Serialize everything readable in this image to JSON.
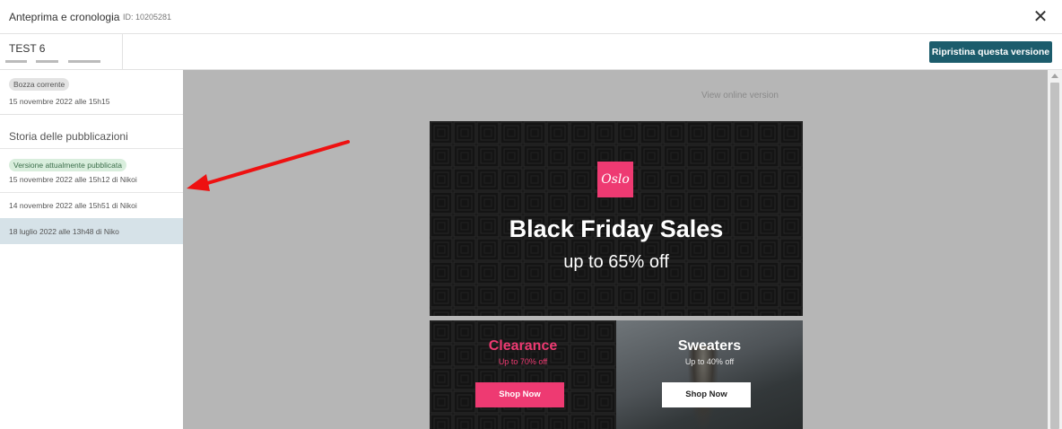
{
  "header": {
    "title": "Anteprima e cronologia",
    "doc_id": "ID: 10205281",
    "close_icon": "close-icon"
  },
  "subheader": {
    "test_name": "TEST 6",
    "restore_label": "Ripristina questa versione"
  },
  "sidebar": {
    "draft": {
      "badge": "Bozza corrente",
      "date": "15 novembre 2022 alle 15h15"
    },
    "history_title": "Storia delle pubblicazioni",
    "versions": [
      {
        "badge": "Versione attualmente pubblicata",
        "date": "15 novembre 2022 alle 15h12 di Nikoi"
      },
      {
        "date": "14 novembre 2022 alle 15h51 di Nikoi"
      },
      {
        "date": "18 luglio 2022 alle 13h48 di Niko",
        "selected": true
      }
    ]
  },
  "preview": {
    "view_online": "View online version",
    "hero": {
      "logo": "Oslo",
      "title": "Black Friday Sales",
      "subtitle": "up to 65% off"
    },
    "left_panel": {
      "title": "Clearance",
      "subtitle": "Up to 70% off",
      "button": "Shop Now"
    },
    "right_panel": {
      "title": "Sweaters",
      "subtitle": "Up to 40% off",
      "button": "Shop Now"
    }
  },
  "colors": {
    "accent": "#1c5c6c",
    "pink": "#ee3a72",
    "selected_row": "#d6e2e8",
    "preview_bg": "#b6b6b6",
    "annotation_arrow": "#ee1111"
  }
}
